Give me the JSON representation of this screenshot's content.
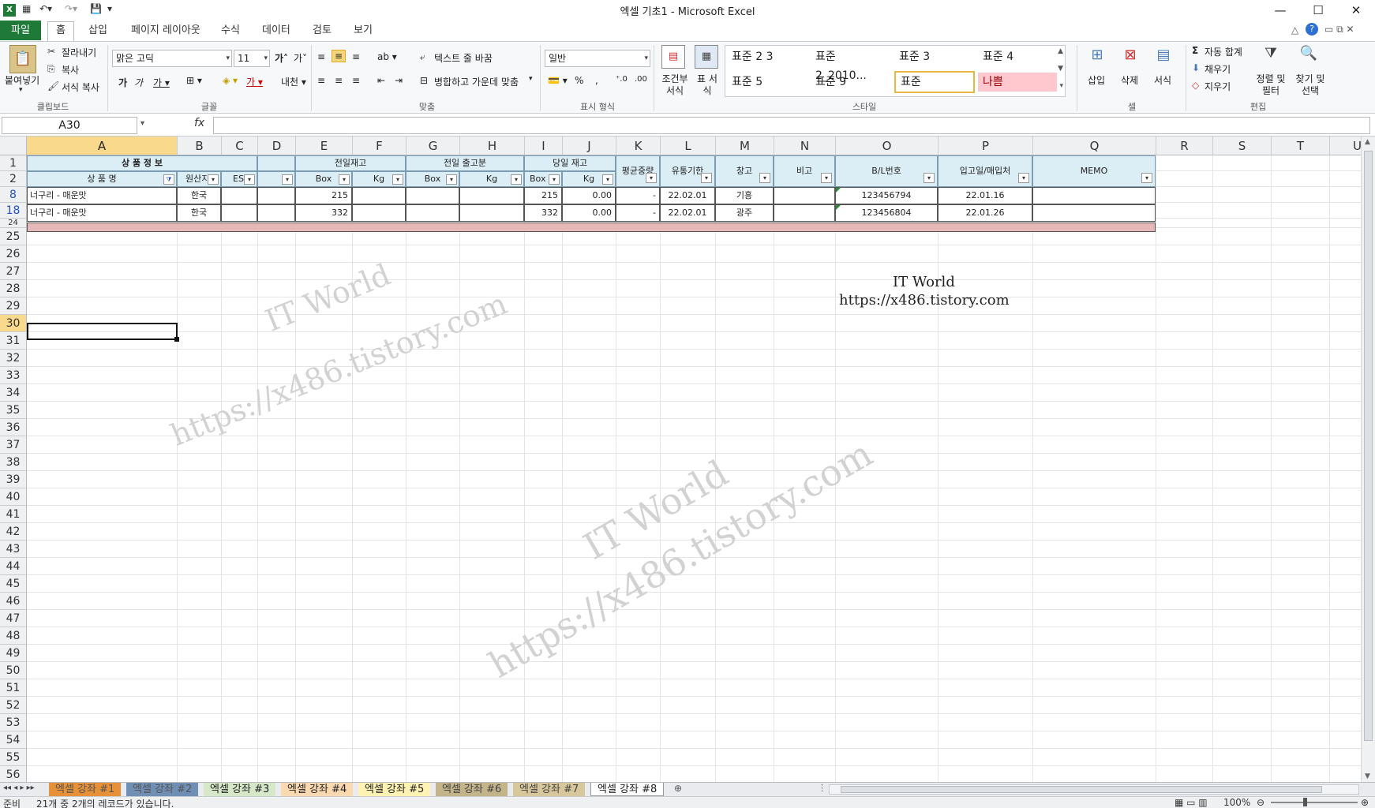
{
  "window": {
    "title": "엑셀 기초1 - Microsoft Excel",
    "minimize": "—",
    "maximize": "☐",
    "close": "✕"
  },
  "menu": {
    "tabs": [
      "파일",
      "홈",
      "삽입",
      "페이지 레이아웃",
      "수식",
      "데이터",
      "검토",
      "보기"
    ]
  },
  "ribbon": {
    "clipboard": {
      "paste": "붙여넣기",
      "cut": "잘라내기",
      "copy": "복사",
      "format_painter": "서식 복사",
      "label": "클립보드"
    },
    "font": {
      "name": "맑은 고딕",
      "size": "11",
      "label": "글꼴"
    },
    "alignment": {
      "wrap": "텍스트 줄 바꿈",
      "merge": "병합하고 가운데 맞춤",
      "label": "맞춤"
    },
    "number": {
      "format": "일반",
      "label": "표시 형식"
    },
    "styles": {
      "conditional": "조건부 서식",
      "table": "표 서식",
      "cells": [
        "표준 2 3",
        "표준 2_2010...",
        "표준 3",
        "표준 4",
        "표준 5",
        "표준 9",
        "표준",
        "나쁨"
      ],
      "label": "스타일"
    },
    "cells": {
      "insert": "삽입",
      "delete": "삭제",
      "format": "서식",
      "label": "셀"
    },
    "editing": {
      "autosum": "자동 합계",
      "fill": "채우기",
      "clear": "지우기",
      "sort": "정렬 및 필터",
      "find": "찾기 및 선택",
      "label": "편집"
    }
  },
  "formula_bar": {
    "name_box": "A30",
    "fx": "fx",
    "value": ""
  },
  "columns": [
    "A",
    "B",
    "C",
    "D",
    "E",
    "F",
    "G",
    "H",
    "I",
    "J",
    "K",
    "L",
    "M",
    "N",
    "O",
    "P",
    "Q",
    "R",
    "S",
    "T",
    "U"
  ],
  "rows": [
    "1",
    "2",
    "8",
    "18",
    "24",
    "25",
    "26",
    "27",
    "28",
    "29",
    "30",
    "31",
    "32",
    "33",
    "34",
    "35",
    "36",
    "37",
    "38",
    "39",
    "40",
    "41",
    "42",
    "43",
    "44",
    "45",
    "46",
    "47",
    "48",
    "49",
    "50",
    "51",
    "52",
    "53",
    "54",
    "55",
    "56"
  ],
  "header1": {
    "product_info": "상 품 정 보",
    "prev_stock": "전일재고",
    "prev_out": "전일 출고분",
    "today_stock": "당일 재고",
    "avg_weight": "평균중량",
    "expiry": "유통기한",
    "warehouse": "창고",
    "note": "비고",
    "bl": "B/L번호",
    "inbound": "입고일/매입처",
    "memo": "MEMO"
  },
  "header2": {
    "product_name": "상 품 명",
    "origin": "원산지",
    "est": "EST",
    "box1": "Box",
    "kg1": "Kg",
    "box2": "Box",
    "kg2": "Kg",
    "box3": "Box",
    "kg3": "Kg"
  },
  "data_rows": [
    {
      "name": "너구리 - 매운맛",
      "origin": "한국",
      "prev_box": "215",
      "today_box": "215",
      "today_kg": "0.00",
      "avg": "-",
      "expiry": "22.02.01",
      "warehouse": "기흥",
      "bl": "123456794",
      "inbound": "22.01.16"
    },
    {
      "name": "너구리 - 매운맛",
      "origin": "한국",
      "prev_box": "332",
      "today_box": "332",
      "today_kg": "0.00",
      "avg": "-",
      "expiry": "22.02.01",
      "warehouse": "광주",
      "bl": "123456804",
      "inbound": "22.01.26"
    }
  ],
  "watermark": {
    "line1": "IT World",
    "line2": "https://x486.tistory.com"
  },
  "sheets": [
    "엑셀 강좌 #1",
    "엑셀 강좌 #2",
    "엑셀 강좌 #3",
    "엑셀 강좌 #4",
    "엑셀 강좌 #5",
    "엑셀 강좌 #6",
    "엑셀 강좌 #7",
    "엑셀 강좌 #8"
  ],
  "status": {
    "ready": "준비",
    "records": "21개 중 2개의 레코드가 있습니다.",
    "zoom": "100%"
  },
  "colors": {
    "file_tab": "#1f7a3a",
    "header_fill": "#dbeef5",
    "pink_row": "#e6b8b7",
    "bad_style": "#ffc7ce",
    "selected_header": "#f9d98b"
  }
}
